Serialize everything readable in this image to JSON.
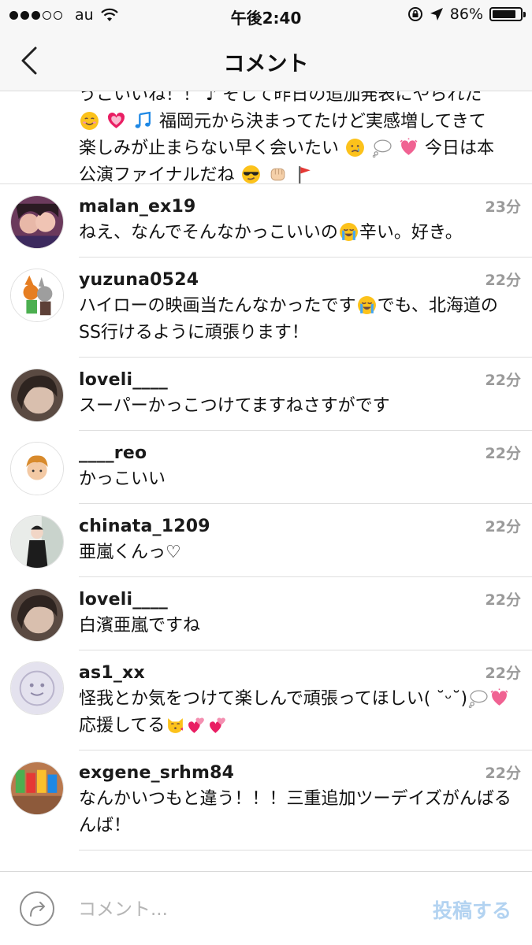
{
  "status_bar": {
    "carrier": "au",
    "time": "午後2:40",
    "battery": "86%",
    "battery_level": 0.86
  },
  "nav": {
    "title": "コメント"
  },
  "partial_comment": {
    "line1": "うこいいね！！ ♪ そして昨日の追加発表にやられた",
    "line2": "福岡元から決まってたけど実感増してきて",
    "line3": "楽しみが止まらない早く会いたい",
    "line3b": "今日は本",
    "line4": "公演ファイナルだね"
  },
  "comments": [
    {
      "username": "malan_ex19",
      "time": "23分",
      "text_a": "ねえ、なんでそんなかっこいいの",
      "text_b": "辛い。好き。"
    },
    {
      "username": "yuzuna0524",
      "time": "22分",
      "text_a": "ハイローの映画当たんなかったです",
      "text_b": "でも、北海道のSS行けるように頑張ります！"
    },
    {
      "username": "loveli____",
      "time": "22分",
      "text_a": "スーパーかっこつけてますねさすがです"
    },
    {
      "username": "____reo",
      "time": "22分",
      "text_a": "かっこいい"
    },
    {
      "username": "chinata_1209",
      "time": "22分",
      "text_a": "亜嵐くんっ♡"
    },
    {
      "username": "loveli____",
      "time": "22分",
      "text_a": "白濱亜嵐ですね"
    },
    {
      "username": "as1_xx",
      "time": "22分",
      "text_a": "怪我とか気をつけて楽しんで頑張ってほしい( ˘ᵕ˘)",
      "text_b": "応援してる"
    },
    {
      "username": "exgene_srhm84",
      "time": "22分",
      "text_a": "なんかいつもと違う！！！三重追加ツーデイズがんばるんば！"
    }
  ],
  "input": {
    "placeholder": "コメント...",
    "post_label": "投稿する"
  },
  "colors": {
    "post_disabled": "#b3d3f1",
    "time_gray": "#9a9a9a",
    "bar_bg": "#f7f7f7"
  }
}
